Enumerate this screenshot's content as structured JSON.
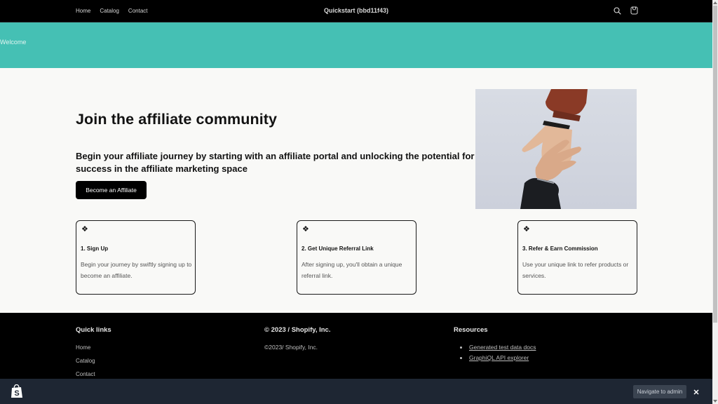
{
  "header": {
    "nav": [
      "Home",
      "Catalog",
      "Contact"
    ],
    "store_title": "Quickstart (bbd11f43)",
    "icons": [
      "search-icon",
      "cart-icon"
    ]
  },
  "banner": {
    "text": "Welcome"
  },
  "hero": {
    "title": "Join the affiliate community",
    "subtitle": "Begin your affiliate journey by starting with an affiliate portal and unlocking the potential for success in the affiliate marketing space",
    "button_label": "Become an Affiliate",
    "image": "two-hands-reaching-photo"
  },
  "cards": [
    {
      "icon": "❖",
      "title": "1. Sign Up",
      "desc": "Begin your journey by swiftly signing up to become an affiliate."
    },
    {
      "icon": "❖",
      "title": "2. Get Unique Referral Link",
      "desc": "After signing up, you'll obtain a unique referral link."
    },
    {
      "icon": "❖",
      "title": "3. Refer & Earn Commission",
      "desc": "Use your unique link to refer products or services."
    }
  ],
  "footer": {
    "quick_links_heading": "Quick links",
    "quick_links": [
      "Home",
      "Catalog",
      "Contact"
    ],
    "copyright_heading": "© 2023 / Shopify, Inc.",
    "copyright_text": "©2023/ Shopify, Inc.",
    "resources_heading": "Resources",
    "resources": [
      "Generated test data docs",
      "GraphiQL API explorer"
    ]
  },
  "admin_bar": {
    "button_label": "Navigate to admin",
    "logo": "shopify-bag-icon"
  },
  "colors": {
    "banner": "#45c0b4",
    "header_bg": "#000000",
    "page_bg": "#f9f9f7",
    "admin_bar_bg": "#1e2633"
  }
}
